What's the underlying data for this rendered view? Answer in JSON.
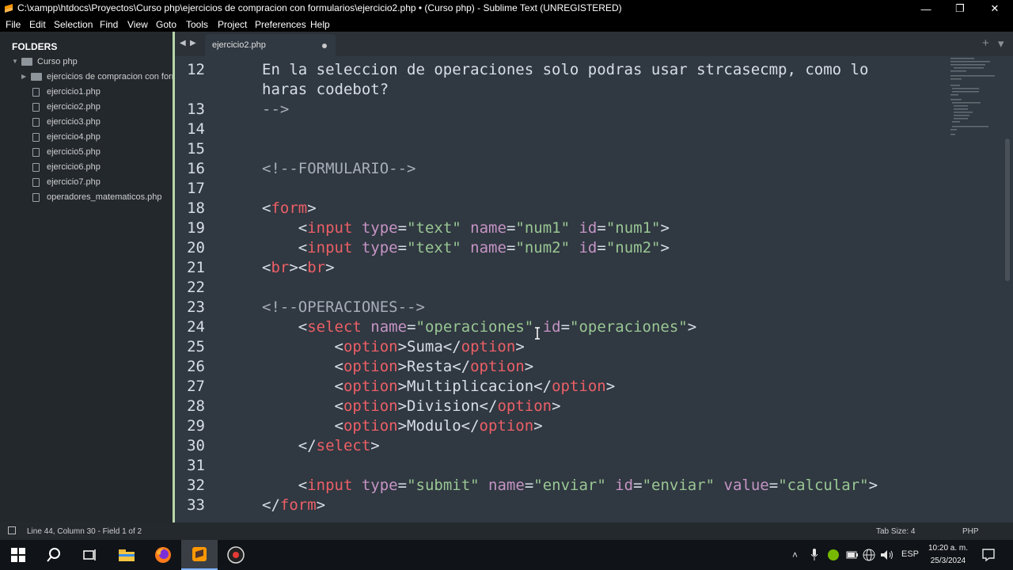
{
  "window": {
    "title": "C:\\xampp\\htdocs\\Proyectos\\Curso php\\ejercicios de compracion con formularios\\ejercicio2.php • (Curso php) - Sublime Text (UNREGISTERED)",
    "minimize_glyph": "—",
    "maximize_glyph": "❐",
    "close_glyph": "✕"
  },
  "menu": [
    "File",
    "Edit",
    "Selection",
    "Find",
    "View",
    "Goto",
    "Tools",
    "Project",
    "Preferences",
    "Help"
  ],
  "sidebar": {
    "header": "FOLDERS",
    "root": "Curso php",
    "subfolder": "ejercicios de compracion con formularios",
    "files": [
      "ejercicio1.php",
      "ejercicio2.php",
      "ejercicio3.php",
      "ejercicio4.php",
      "ejercicio5.php",
      "ejercicio6.php",
      "ejercicio7.php",
      "operadores_matematicos.php"
    ]
  },
  "tabs": {
    "active": "ejercicio2.php",
    "prev_glyph": "◀",
    "next_glyph": "▶",
    "new_tab_glyph": "+",
    "overflow_glyph": "▾"
  },
  "editor": {
    "lines": [
      {
        "n": "12",
        "segs": [
          [
            "tx",
            "En la seleccion de operaciones solo podras usar strcasecmp, como lo"
          ]
        ]
      },
      {
        "n": "",
        "segs": [
          [
            "tx",
            "haras codebot?"
          ]
        ]
      },
      {
        "n": "13",
        "segs": [
          [
            "cm",
            "-->"
          ]
        ]
      },
      {
        "n": "14",
        "segs": []
      },
      {
        "n": "15",
        "segs": []
      },
      {
        "n": "16",
        "segs": [
          [
            "cm",
            "<!--FORMULARIO-->"
          ]
        ]
      },
      {
        "n": "17",
        "segs": []
      },
      {
        "n": "18",
        "segs": [
          [
            "tx",
            "<"
          ],
          [
            "tg",
            "form"
          ],
          [
            "tx",
            ">"
          ]
        ]
      },
      {
        "n": "19",
        "segs": [
          [
            "tx",
            "    <"
          ],
          [
            "tg",
            "input"
          ],
          [
            "tx",
            " "
          ],
          [
            "at",
            "type"
          ],
          [
            "tx",
            "="
          ],
          [
            "st",
            "\"text\""
          ],
          [
            "tx",
            " "
          ],
          [
            "at",
            "name"
          ],
          [
            "tx",
            "="
          ],
          [
            "st",
            "\"num1\""
          ],
          [
            "tx",
            " "
          ],
          [
            "at",
            "id"
          ],
          [
            "tx",
            "="
          ],
          [
            "st",
            "\"num1\""
          ],
          [
            "tx",
            ">"
          ]
        ]
      },
      {
        "n": "20",
        "segs": [
          [
            "tx",
            "    <"
          ],
          [
            "tg",
            "input"
          ],
          [
            "tx",
            " "
          ],
          [
            "at",
            "type"
          ],
          [
            "tx",
            "="
          ],
          [
            "st",
            "\"text\""
          ],
          [
            "tx",
            " "
          ],
          [
            "at",
            "name"
          ],
          [
            "tx",
            "="
          ],
          [
            "st",
            "\"num2\""
          ],
          [
            "tx",
            " "
          ],
          [
            "at",
            "id"
          ],
          [
            "tx",
            "="
          ],
          [
            "st",
            "\"num2\""
          ],
          [
            "tx",
            ">"
          ]
        ]
      },
      {
        "n": "21",
        "segs": [
          [
            "tx",
            "<"
          ],
          [
            "tg",
            "br"
          ],
          [
            "tx",
            "><"
          ],
          [
            "tg",
            "br"
          ],
          [
            "tx",
            ">"
          ]
        ]
      },
      {
        "n": "22",
        "segs": []
      },
      {
        "n": "23",
        "segs": [
          [
            "cm",
            "<!--OPERACIONES-->"
          ]
        ]
      },
      {
        "n": "24",
        "segs": [
          [
            "tx",
            "    <"
          ],
          [
            "tg",
            "select"
          ],
          [
            "tx",
            " "
          ],
          [
            "at",
            "name"
          ],
          [
            "tx",
            "="
          ],
          [
            "st",
            "\"operaciones\""
          ],
          [
            "tx",
            " "
          ],
          [
            "at",
            "id"
          ],
          [
            "tx",
            "="
          ],
          [
            "st",
            "\"operaciones\""
          ],
          [
            "tx",
            ">"
          ]
        ]
      },
      {
        "n": "25",
        "segs": [
          [
            "tx",
            "        <"
          ],
          [
            "tg",
            "option"
          ],
          [
            "tx",
            ">Suma</"
          ],
          [
            "tg",
            "option"
          ],
          [
            "tx",
            ">"
          ]
        ]
      },
      {
        "n": "26",
        "segs": [
          [
            "tx",
            "        <"
          ],
          [
            "tg",
            "option"
          ],
          [
            "tx",
            ">Resta</"
          ],
          [
            "tg",
            "option"
          ],
          [
            "tx",
            ">"
          ]
        ]
      },
      {
        "n": "27",
        "segs": [
          [
            "tx",
            "        <"
          ],
          [
            "tg",
            "option"
          ],
          [
            "tx",
            ">Multiplicacion</"
          ],
          [
            "tg",
            "option"
          ],
          [
            "tx",
            ">"
          ]
        ]
      },
      {
        "n": "28",
        "segs": [
          [
            "tx",
            "        <"
          ],
          [
            "tg",
            "option"
          ],
          [
            "tx",
            ">Division</"
          ],
          [
            "tg",
            "option"
          ],
          [
            "tx",
            ">"
          ]
        ]
      },
      {
        "n": "29",
        "segs": [
          [
            "tx",
            "        <"
          ],
          [
            "tg",
            "option"
          ],
          [
            "tx",
            ">Modulo</"
          ],
          [
            "tg",
            "option"
          ],
          [
            "tx",
            ">"
          ]
        ]
      },
      {
        "n": "30",
        "segs": [
          [
            "tx",
            "    </"
          ],
          [
            "tg",
            "select"
          ],
          [
            "tx",
            ">"
          ]
        ]
      },
      {
        "n": "31",
        "segs": []
      },
      {
        "n": "32",
        "segs": [
          [
            "tx",
            "    <"
          ],
          [
            "tg",
            "input"
          ],
          [
            "tx",
            " "
          ],
          [
            "at",
            "type"
          ],
          [
            "tx",
            "="
          ],
          [
            "st",
            "\"submit\""
          ],
          [
            "tx",
            " "
          ],
          [
            "at",
            "name"
          ],
          [
            "tx",
            "="
          ],
          [
            "st",
            "\"enviar\""
          ],
          [
            "tx",
            " "
          ],
          [
            "at",
            "id"
          ],
          [
            "tx",
            "="
          ],
          [
            "st",
            "\"enviar\""
          ],
          [
            "tx",
            " "
          ],
          [
            "at",
            "value"
          ],
          [
            "tx",
            "="
          ],
          [
            "st",
            "\"calcular\""
          ],
          [
            "tx",
            ">"
          ]
        ]
      },
      {
        "n": "33",
        "segs": [
          [
            "tx",
            "</"
          ],
          [
            "tg",
            "form"
          ],
          [
            "tx",
            ">"
          ]
        ]
      }
    ]
  },
  "status": {
    "position": "Line 44, Column 30 - Field 1 of 2",
    "tab_size": "Tab Size: 4",
    "syntax": "PHP"
  },
  "taskbar": {
    "language": "ESP",
    "time": "10:20 a. m.",
    "date": "25/3/2024"
  },
  "colors": {
    "editor_bg": "#303841",
    "tag": "#ec5f66",
    "attribute": "#c594c5",
    "string": "#99c794",
    "text": "#d8dee9",
    "comment": "#a7adba",
    "sidebar_accent": "#b8d6a8"
  }
}
